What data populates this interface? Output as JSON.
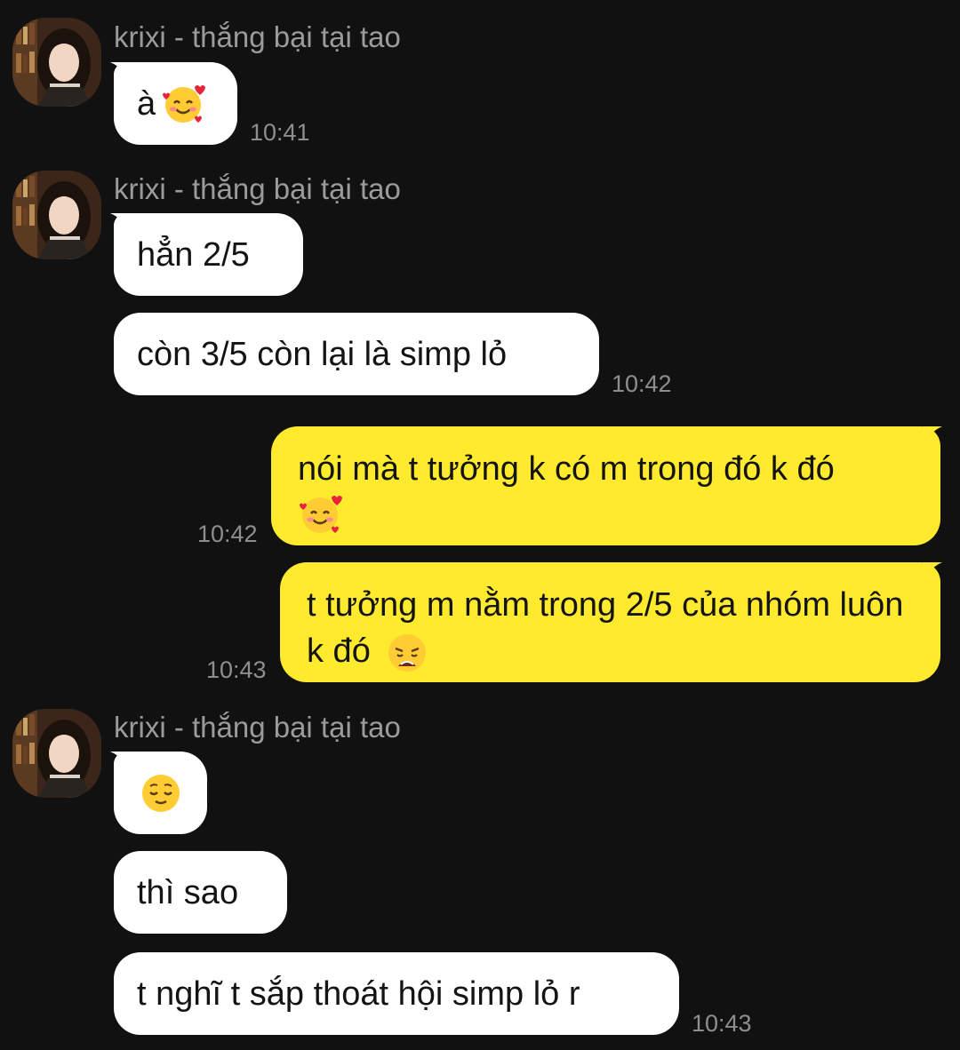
{
  "sender_name": "krixi - thắng bại tại tao",
  "groups": [
    {
      "sender": "krixi - thắng bại tại tao",
      "messages": [
        {
          "text": "à",
          "emoji": "smiling-face-with-hearts-emoji",
          "time": "10:41"
        }
      ]
    },
    {
      "sender": "krixi - thắng bại tại tao",
      "messages": [
        {
          "text": "hẳn 2/5"
        },
        {
          "text": "còn 3/5 còn lại là simp lỏ",
          "time": "10:42"
        }
      ]
    },
    {
      "outgoing": true,
      "messages": [
        {
          "text": "nói mà t tưởng k có m trong đó k đó",
          "emoji": "smiling-face-with-hearts-emoji",
          "time": "10:42"
        },
        {
          "text": "t tưởng m nằm trong 2/5 của nhóm luôn k đó",
          "emoji": "weary-face-emoji",
          "time": "10:43"
        }
      ]
    },
    {
      "sender": "krixi - thắng bại tại tao",
      "messages": [
        {
          "emoji": "relieved-face-emoji"
        },
        {
          "text": "thì sao"
        },
        {
          "text": "t nghĩ t sắp thoát hội simp lỏ r",
          "time": "10:43"
        }
      ]
    }
  ],
  "colors": {
    "background": "#111111",
    "incoming_bubble": "#ffffff",
    "outgoing_bubble": "#ffea2e",
    "sender_text": "#9b9b9b",
    "time_text": "#8e8e8e"
  }
}
